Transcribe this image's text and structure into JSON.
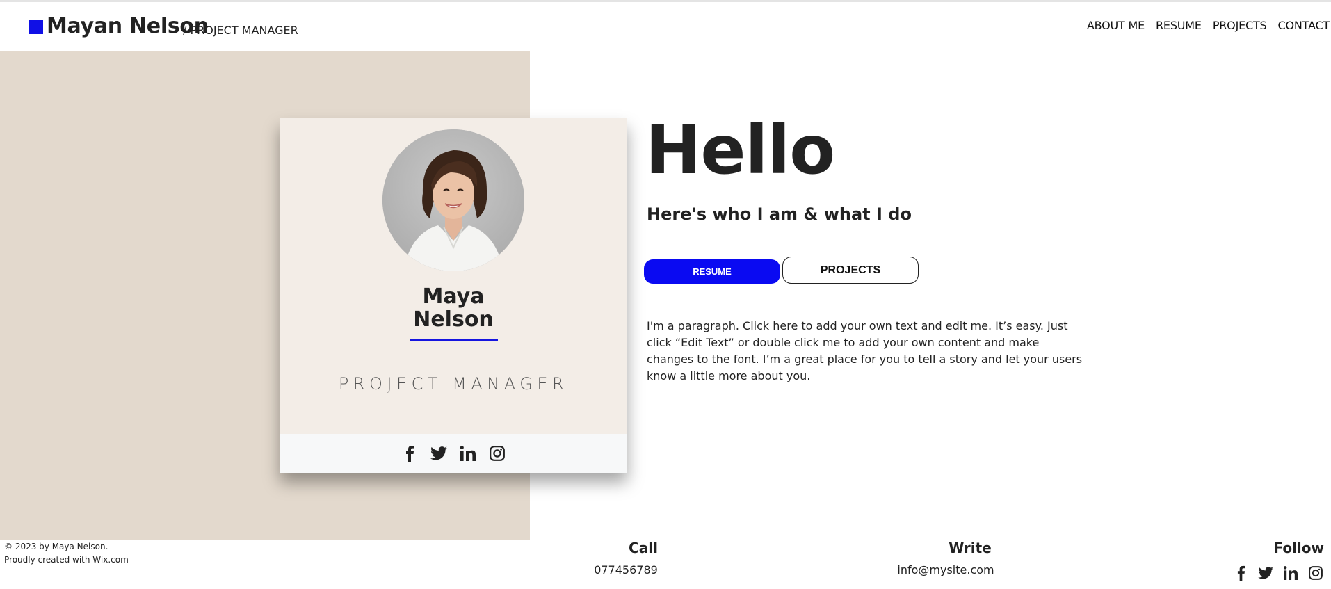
{
  "header": {
    "site_name": "Mayan Nelson",
    "site_role": "/ PROJECT MANAGER",
    "nav": [
      "ABOUT ME",
      "RESUME",
      "PROJECTS",
      "CONTACT"
    ]
  },
  "card": {
    "name_line1": "Maya",
    "name_line2": "Nelson",
    "role": "PROJECT MANAGER",
    "social_icons": [
      "facebook-icon",
      "twitter-icon",
      "linkedin-icon",
      "instagram-icon"
    ]
  },
  "hero": {
    "title": "Hello",
    "subtitle": "Here's who I am & what I do",
    "resume_button": "RESUME",
    "projects_button": "PROJECTS",
    "paragraph": "I'm a paragraph. Click here to add your own text and edit me. It’s easy. Just click “Edit Text” or double click me to add your own content and make changes to the font. I’m a great place for you to tell a story and let your users know a little more about you."
  },
  "footer": {
    "copyright_line1": "© 2023 by Maya Nelson.",
    "copyright_line2": "Proudly created with Wix.com",
    "call_heading": "Call",
    "call_value": "077456789",
    "write_heading": "Write",
    "write_value": "info@mysite.com",
    "follow_heading": "Follow"
  },
  "colors": {
    "accent": "#0a0af2",
    "panel": "#e3d9cd",
    "card": "#f3ede7"
  }
}
